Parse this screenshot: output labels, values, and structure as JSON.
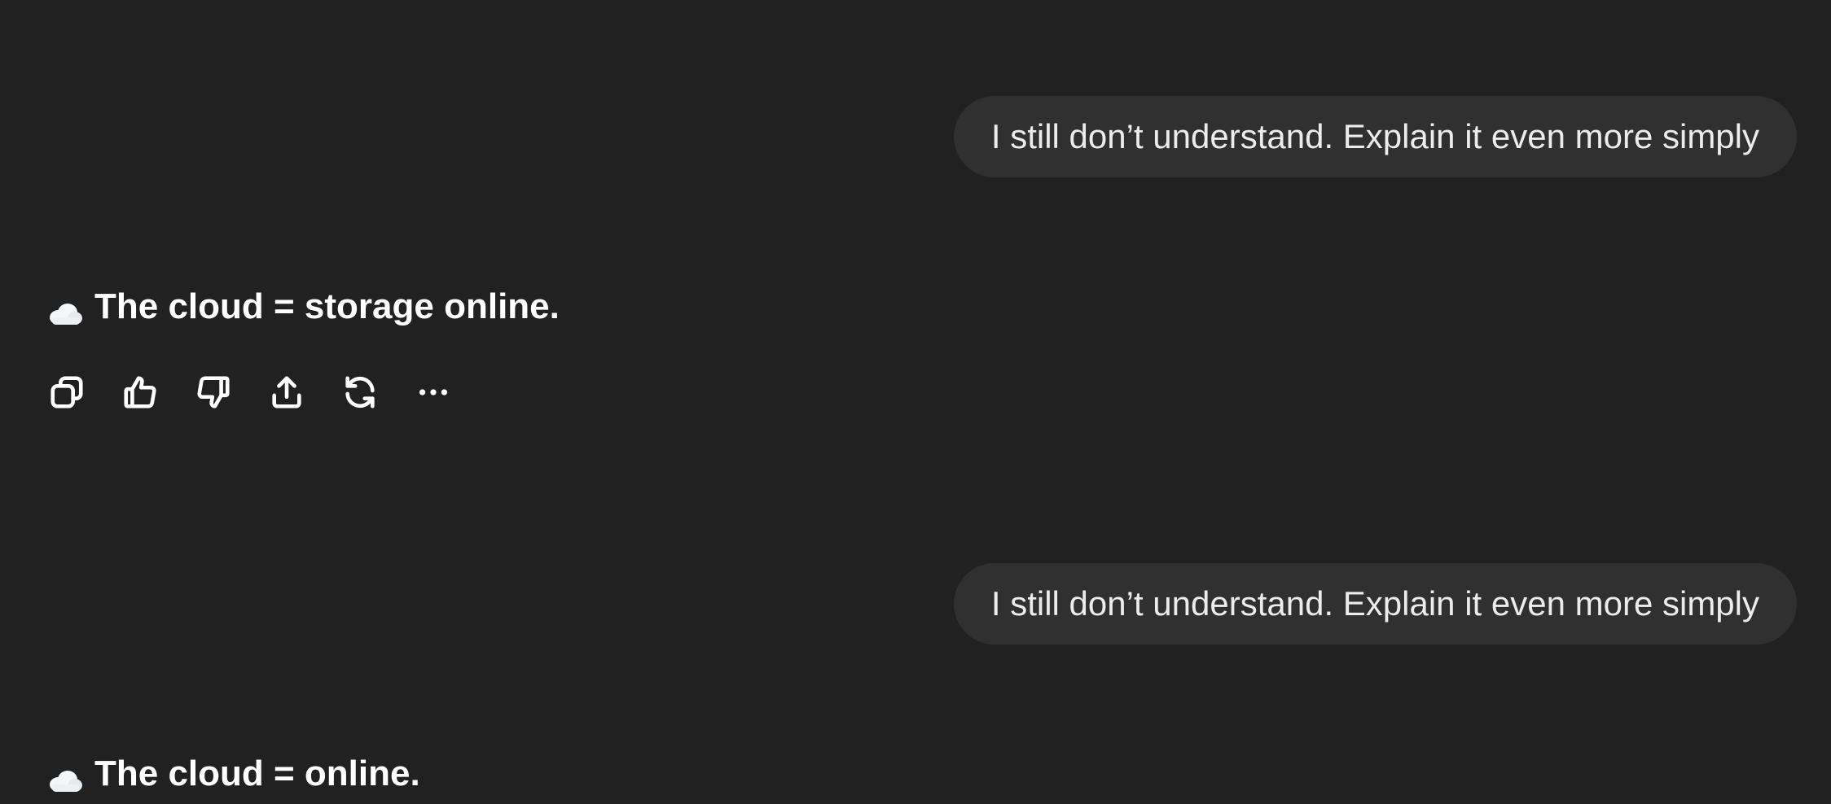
{
  "conversation": {
    "messages": [
      {
        "role": "user",
        "text": "I still don’t understand. Explain it even more simply"
      },
      {
        "role": "assistant",
        "icon": "cloud-icon",
        "text": "The cloud = storage online."
      },
      {
        "role": "user",
        "text": "I still don’t understand. Explain it even more simply"
      },
      {
        "role": "assistant",
        "icon": "cloud-icon",
        "text": "The cloud = online."
      }
    ]
  },
  "actions": {
    "icons": [
      "copy-icon",
      "thumbs-up-icon",
      "thumbs-down-icon",
      "share-icon",
      "regenerate-icon",
      "more-icon"
    ]
  },
  "colors": {
    "background": "#212121",
    "user_bubble": "#303030",
    "text": "#ececec"
  }
}
